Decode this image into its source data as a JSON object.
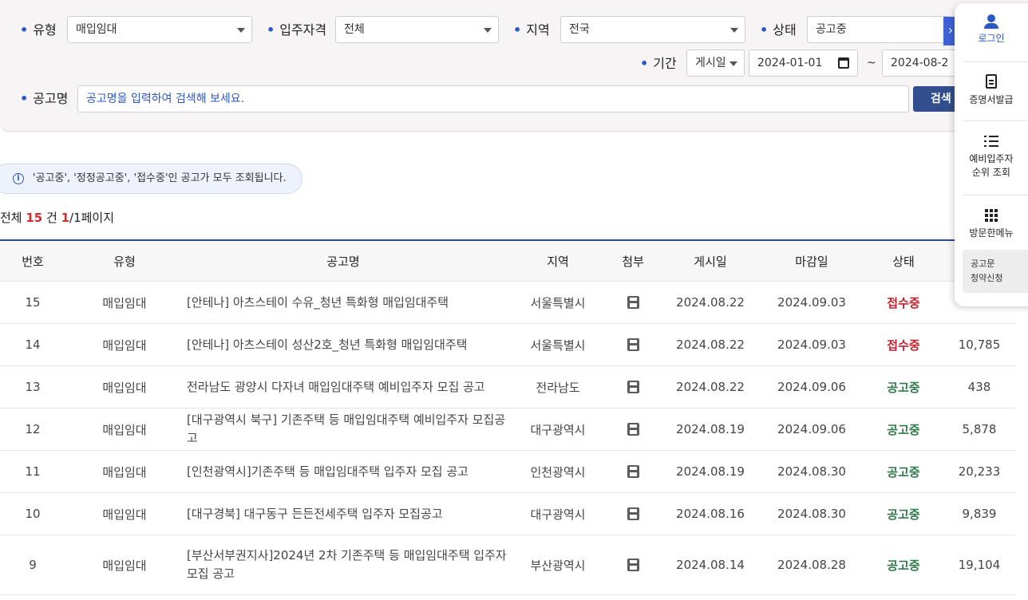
{
  "filters": {
    "type_label": "유형",
    "type_value": "매입임대",
    "eligibility_label": "입주자격",
    "eligibility_value": "전체",
    "region_label": "지역",
    "region_value": "전국",
    "status_label": "상태",
    "status_value": "공고중",
    "period_label": "기간",
    "period_type": "게시일",
    "date_from": "2024-01-01",
    "date_to": "2024-08-2",
    "tilde": "~",
    "title_label": "공고명",
    "title_placeholder": "공고명을 입력하여 검색해 보세요.",
    "search_button": "검색"
  },
  "notice": "'공고중', '정정공고중', '접수중'인 공고가 모두 조회됩니다.",
  "summary": {
    "prefix": "전체 ",
    "count": "15",
    "mid": " 건  ",
    "page": "1",
    "suffix": "/1페이지"
  },
  "table": {
    "headers": {
      "no": "번호",
      "type": "유형",
      "title": "공고명",
      "region": "지역",
      "attachment": "첨부",
      "posted": "게시일",
      "deadline": "마감일",
      "status": "상태"
    },
    "rows": [
      {
        "no": "15",
        "type": "매입임대",
        "title": "[안테나] 아츠스테이 수유_청년 특화형 매입임대주택",
        "region": "서울특별시",
        "posted": "2024.08.22",
        "deadline": "2024.09.03",
        "status": "접수중",
        "views": ""
      },
      {
        "no": "14",
        "type": "매입임대",
        "title": "[안테나] 아츠스테이 성산2호_청년 특화형 매입임대주택",
        "region": "서울특별시",
        "posted": "2024.08.22",
        "deadline": "2024.09.03",
        "status": "접수중",
        "views": "10,785"
      },
      {
        "no": "13",
        "type": "매입임대",
        "title": "전라남도 광양시 다자녀 매입임대주택 예비입주자 모집 공고",
        "region": "전라남도",
        "posted": "2024.08.22",
        "deadline": "2024.09.06",
        "status": "공고중",
        "views": "438"
      },
      {
        "no": "12",
        "type": "매입임대",
        "title": "[대구광역시 북구] 기존주택 등 매입임대주택 예비입주자 모집공고",
        "region": "대구광역시",
        "posted": "2024.08.19",
        "deadline": "2024.09.06",
        "status": "공고중",
        "views": "5,878"
      },
      {
        "no": "11",
        "type": "매입임대",
        "title": "[인천광역시]기존주택 등 매입임대주택 입주자 모집 공고",
        "region": "인천광역시",
        "posted": "2024.08.19",
        "deadline": "2024.08.30",
        "status": "공고중",
        "views": "20,233"
      },
      {
        "no": "10",
        "type": "매입임대",
        "title": "[대구경북] 대구동구 든든전세주택 입주자 모집공고",
        "region": "대구광역시",
        "posted": "2024.08.16",
        "deadline": "2024.08.30",
        "status": "공고중",
        "views": "9,839"
      },
      {
        "no": "9",
        "type": "매입임대",
        "title": "[부산서부권지사]2024년 2차 기존주택 등 매입임대주택 입주자 모집 공고",
        "region": "부산광역시",
        "posted": "2024.08.14",
        "deadline": "2024.08.28",
        "status": "공고중",
        "views": "19,104"
      }
    ]
  },
  "quick_menu": {
    "login": "로그인",
    "certificate": "증명서발급",
    "waitlist_line1": "예비입주자",
    "waitlist_line2": "순위 조회",
    "popular": "방문한메뉴",
    "notice_line1": "공고문",
    "notice_line2": "청약신청"
  },
  "colors": {
    "accent": "#2b59c3",
    "header_border": "#2d4a8a",
    "status_receiving": "#c6202a",
    "status_open": "#2f7a4a"
  }
}
